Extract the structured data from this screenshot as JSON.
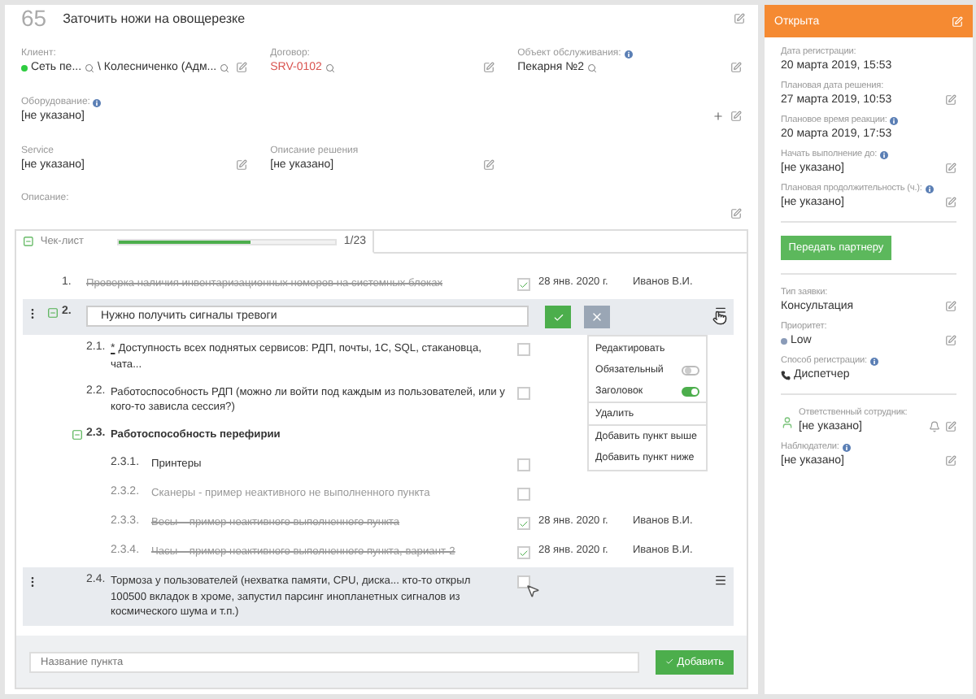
{
  "task": {
    "number": "65",
    "title": "Заточить ножи на овощерезке"
  },
  "client": {
    "label": "Клиент:",
    "name": "Сеть пе...",
    "contact": "\\ Колесниченко (Адм..."
  },
  "contract": {
    "label": "Договор:",
    "value": "SRV-0102"
  },
  "service_object": {
    "label": "Объект обслуживания:",
    "value": "Пекарня №2"
  },
  "equipment": {
    "label": "Оборудование:",
    "value": "[не указано]"
  },
  "service": {
    "label": "Service",
    "value": "[не указано]"
  },
  "solution": {
    "label": "Описание решения",
    "value": "[не указано]"
  },
  "description": {
    "label": "Описание:"
  },
  "checklist": {
    "tab": "Чек-лист",
    "expanded": true,
    "level": 0.61,
    "count": "1/23",
    "items": [
      {
        "number": "1.",
        "text": "Проверка наличия инвентаризационных номеров на системных блоках",
        "kind": "task",
        "checked": true,
        "inactive": false,
        "selected": false,
        "date": "28 янв. 2020 г.",
        "author": "Иванов В.И."
      },
      {
        "number": "2.",
        "text": "Нужно получить сигналы тревоги",
        "kind": "editing",
        "selected": true,
        "expanded": true,
        "children": [
          {
            "number": "2.1.",
            "marker": "*",
            "text": "Доступность всех поднятых сервисов: РДП, почты, 1С, SQL, стакановца, чата...",
            "kind": "task",
            "checked": false,
            "inactive": false,
            "selected": false
          },
          {
            "number": "2.2.",
            "text": "Работоспособность РДП (можно ли войти под каждым из пользователей, или у кого-то зависла сессия?)",
            "kind": "task",
            "checked": false,
            "inactive": false,
            "selected": false
          },
          {
            "number": "2.3.",
            "text": "Работоспособность перефирии",
            "kind": "heading",
            "selected": false,
            "expanded": true,
            "children": [
              {
                "number": "2.3.1.",
                "text": "Принтеры",
                "kind": "task",
                "checked": false,
                "inactive": false,
                "selected": false
              },
              {
                "number": "2.3.2.",
                "text": "Сканеры - пример неактивного не выполненного пункта",
                "kind": "task",
                "checked": false,
                "inactive": true,
                "selected": false
              },
              {
                "number": "2.3.3.",
                "text": "Весы – пример неактивного выполненного пункта",
                "kind": "task",
                "checked": true,
                "inactive": true,
                "selected": false,
                "date": "28 янв. 2020 г.",
                "author": "Иванов В.И."
              },
              {
                "number": "2.3.4.",
                "text": "Часы – пример неактивного выполненного пункта, вариант-2",
                "kind": "task",
                "checked": true,
                "inactive": true,
                "selected": false,
                "date": "28 янв. 2020 г.",
                "author": "Иванов В.И."
              }
            ]
          },
          {
            "number": "2.4.",
            "text": "Тормоза у пользователей (нехватка памяти, CPU, диска... кто-то открыл 100500 вкладок в хроме, запустил парсинг инопланетных сигналов из космического шума и т.п.)",
            "kind": "task",
            "checked": false,
            "inactive": false,
            "selected": true
          }
        ]
      }
    ],
    "menu": [
      {
        "label": "Редактировать",
        "kind": "action",
        "section_start": false
      },
      {
        "label": "Обязательный",
        "kind": "toggle",
        "on": false,
        "section_start": false
      },
      {
        "label": "Заголовок",
        "kind": "toggle",
        "on": true,
        "section_start": false
      },
      {
        "label": "Удалить",
        "kind": "action",
        "section_start": true
      },
      {
        "label": "Добавить пункт выше",
        "kind": "action",
        "section_start": true
      },
      {
        "label": "Добавить пункт ниже",
        "kind": "action",
        "section_start": false
      }
    ],
    "new_item": {
      "placeholder": "Название пункта"
    },
    "add_button": "Добавить"
  },
  "status": {
    "label": "Открыта"
  },
  "dates": [
    {
      "label": "Дата регистрации:",
      "value": "20 марта 2019, 15:53",
      "info": false,
      "editable": false
    },
    {
      "label": "Плановая дата решения:",
      "value": "27 марта 2019, 10:53",
      "info": false,
      "editable": true
    },
    {
      "label": "Плановое время реакции:",
      "value": "20 марта 2019, 17:53",
      "info": true,
      "editable": false
    },
    {
      "label": "Начать выполнение до:",
      "value": "[не указано]",
      "info": true,
      "editable": true
    },
    {
      "label": "Плановая продолжительность (ч.):",
      "value": "[не указано]",
      "info": true,
      "editable": true
    }
  ],
  "transfer_button": "Передать партнеру",
  "properties": [
    {
      "label": "Тип заявки:",
      "value": "Консультация",
      "kind": "text",
      "info": false,
      "editable": true
    },
    {
      "label": "Приоритет:",
      "value": "Low",
      "kind": "priority",
      "info": false,
      "editable": true
    },
    {
      "label": "Способ регистрации:",
      "value": "Диспетчер",
      "kind": "phone",
      "info": true,
      "editable": false
    }
  ],
  "assignee": {
    "label": "Ответственный сотрудник:",
    "value": "[не указано]"
  },
  "observers": {
    "label": "Наблюдатели:",
    "value": "[не указано]",
    "info": true
  }
}
